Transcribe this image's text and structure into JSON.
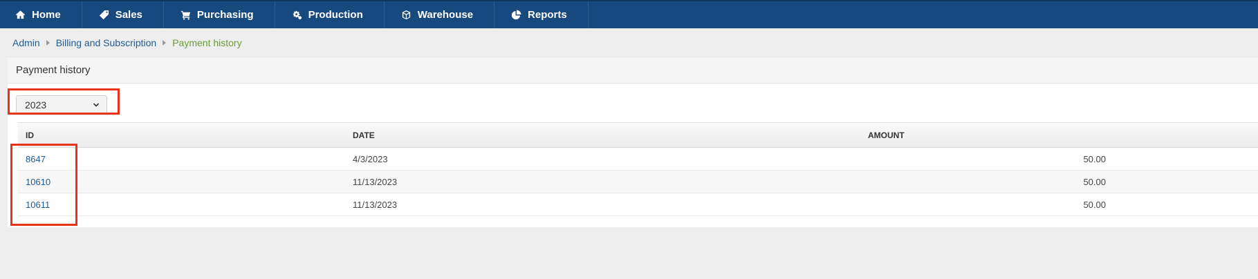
{
  "nav": {
    "items": [
      {
        "label": "Home",
        "icon": "home-icon"
      },
      {
        "label": "Sales",
        "icon": "tag-icon"
      },
      {
        "label": "Purchasing",
        "icon": "cart-icon"
      },
      {
        "label": "Production",
        "icon": "gears-icon"
      },
      {
        "label": "Warehouse",
        "icon": "cube-icon"
      },
      {
        "label": "Reports",
        "icon": "pie-chart-icon"
      }
    ]
  },
  "breadcrumb": {
    "items": [
      "Admin",
      "Billing and Subscription"
    ],
    "current": "Payment history"
  },
  "panel": {
    "title": "Payment history"
  },
  "filter": {
    "year": "2023"
  },
  "table": {
    "columns": [
      "ID",
      "DATE",
      "AMOUNT"
    ],
    "rows": [
      {
        "id": "8647",
        "date": "4/3/2023",
        "amount": "50.00"
      },
      {
        "id": "10610",
        "date": "11/13/2023",
        "amount": "50.00"
      },
      {
        "id": "10611",
        "date": "11/13/2023",
        "amount": "50.00"
      }
    ]
  },
  "colors": {
    "navbar": "#18497e",
    "link": "#1f5b95",
    "current_crumb": "#6a9a37",
    "highlight": "#e8321c"
  }
}
